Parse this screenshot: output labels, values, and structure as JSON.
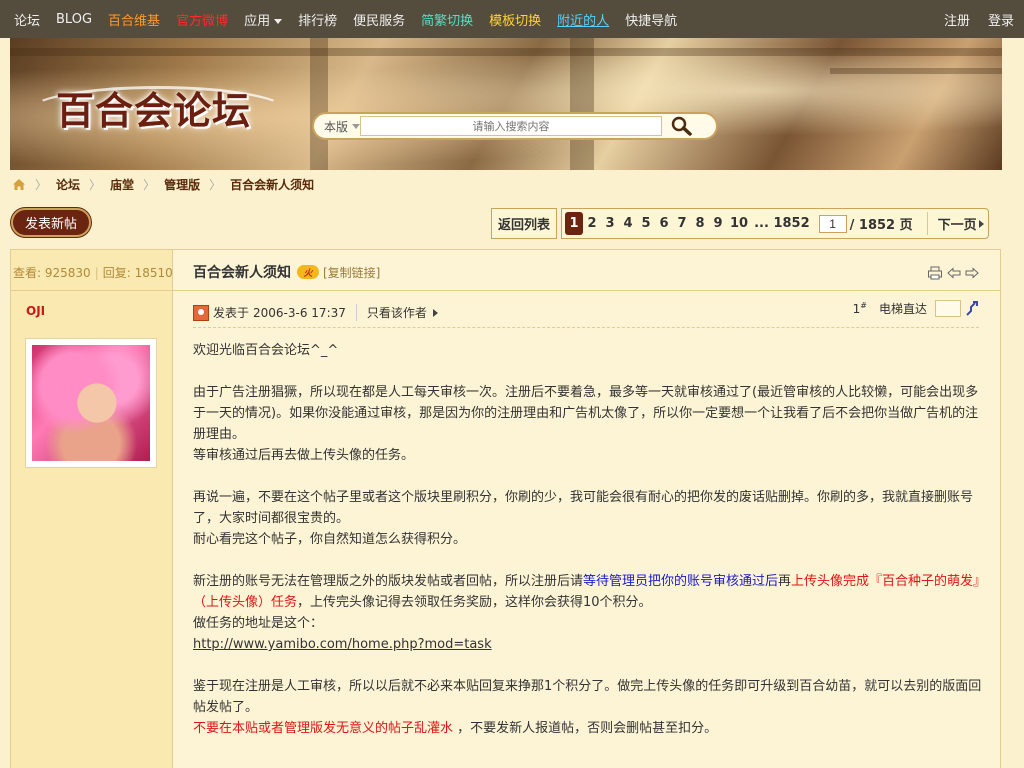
{
  "topnav": {
    "items": [
      {
        "label": "论坛",
        "color": "#f0f0f0"
      },
      {
        "label": "BLOG",
        "color": "#f0f0f0"
      },
      {
        "label": "百合维基",
        "color": "#ff9a2a"
      },
      {
        "label": "官方微博",
        "color": "#ff2a2a"
      },
      {
        "label": "应用",
        "color": "#f0f0f0"
      },
      {
        "label": "排行榜",
        "color": "#f0f0f0"
      },
      {
        "label": "便民服务",
        "color": "#f0f0f0"
      },
      {
        "label": "简繁切换",
        "color": "#55e0c0"
      },
      {
        "label": "模板切换",
        "color": "#ffd23a"
      },
      {
        "label": "附近的人",
        "color": "#55d0ff"
      },
      {
        "label": "快捷导航",
        "color": "#f0f0f0"
      }
    ],
    "register": "注册",
    "login": "登录"
  },
  "banner": {
    "logo_text": "百合会论坛",
    "search_scope": "本版",
    "search_placeholder": "请输入搜索内容"
  },
  "breadcrumb": [
    "论坛",
    "庙堂",
    "管理版",
    "百合会新人须知"
  ],
  "new_post_label": "发表新帖",
  "pager": {
    "back_label": "返回列表",
    "pages": [
      "1",
      "2",
      "3",
      "4",
      "5",
      "6",
      "7",
      "8",
      "9",
      "10",
      "... 1852"
    ],
    "current": "1",
    "jump_value": "1",
    "total_label": "/ 1852 页",
    "next_label": "下一页"
  },
  "thread": {
    "stats_views_label": "查看:",
    "stats_views": "925830",
    "stats_replies_label": "回复:",
    "stats_replies": "18510",
    "title": "百合会新人须知",
    "hot_badge": "火",
    "copy_link": "[复制链接]",
    "author": "OJI",
    "posted_prefix": "发表于",
    "posted_time": "2006-3-6 17:37",
    "only_author": "只看该作者",
    "floor": "1",
    "floor_mark": "#",
    "goto_label": "电梯直达",
    "body": {
      "p1": "欢迎光临百合会论坛^_^",
      "p2a": "由于广告注册猖獗，所以现在都是人工每天审核一次。注册后不要着急，最多等一天就审核通过了(最近管审核的人比较懒，可能会出现多于一天的情况)。如果你没能通过审核，那是因为你的注册理由和广告机太像了，所以你一定要想一个让我看了后不会把你当做广告机的注册理由。",
      "p2b": "等审核通过后再去做上传头像的任务。",
      "p3a": "再说一遍，不要在这个帖子里或者这个版块里刷积分，你刷的少，我可能会很有耐心的把你发的废话贴删掉。你刷的多，我就直接删账号了，大家时间都很宝贵的。",
      "p3b": "耐心看完这个帖子，你自然知道怎么获得积分。",
      "p4_1": "新注册的账号无法在管理版之外的版块发帖或者回帖，所以注册后请",
      "p4_2": "等待管理员把你的账号审核通过后",
      "p4_3": "再",
      "p4_4": "上传头像完成『百合种子的萌发』（上传头像）任务",
      "p4_5": "，上传完头像记得去领取任务奖励，这样你会获得10个积分。",
      "p4b": "做任务的地址是这个：",
      "p4_link": "http://www.yamibo.com/home.php?mod=task",
      "p5a": "鉴于现在注册是人工审核，所以以后就不必来本贴回复来挣那1个积分了。做完上传头像的任务即可升级到百合幼苗，就可以去别的版面回帖发帖了。",
      "p5_red": "不要在本贴或者管理版发无意义的帖子乱灌水",
      "p5_rest": " ，不要发新人报道帖，否则会删帖甚至扣分。"
    }
  },
  "colors": {
    "accent": "#6a2410",
    "background": "#fbf1cf",
    "author": "#c81a1a",
    "highlight_blue": "#1a1acc",
    "highlight_red": "#e01515"
  }
}
